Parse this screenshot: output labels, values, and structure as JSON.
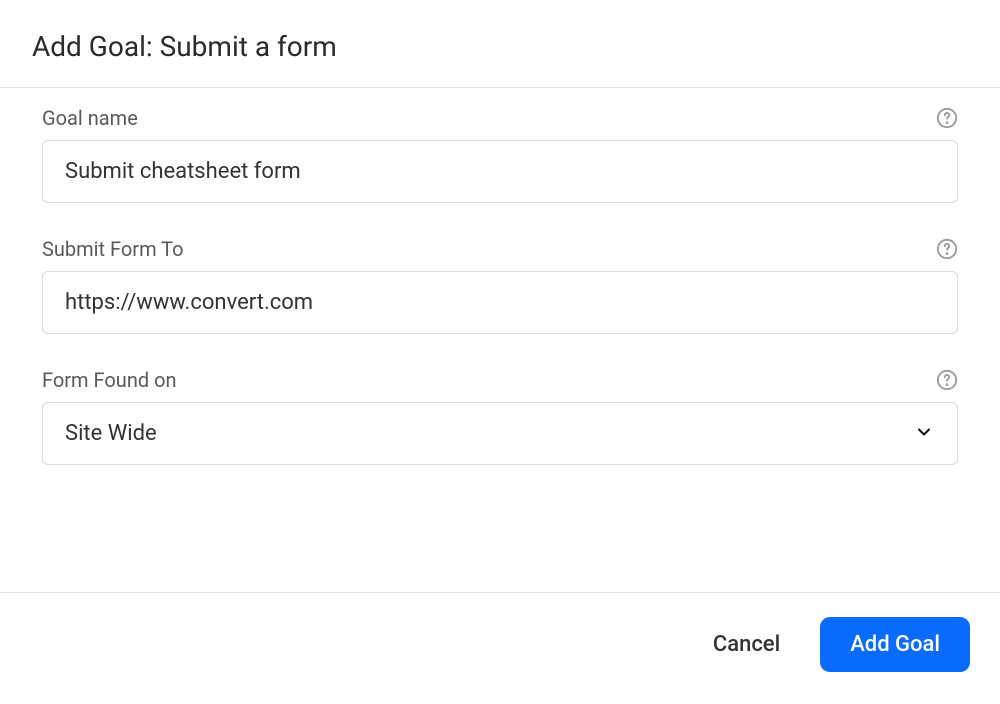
{
  "header": {
    "title": "Add Goal: Submit a form"
  },
  "fields": {
    "goal_name": {
      "label": "Goal name",
      "value": "Submit cheatsheet form"
    },
    "submit_form_to": {
      "label": "Submit Form To",
      "value": "https://www.convert.com"
    },
    "form_found_on": {
      "label": "Form Found on",
      "selected": "Site Wide"
    }
  },
  "footer": {
    "cancel_label": "Cancel",
    "submit_label": "Add Goal"
  }
}
